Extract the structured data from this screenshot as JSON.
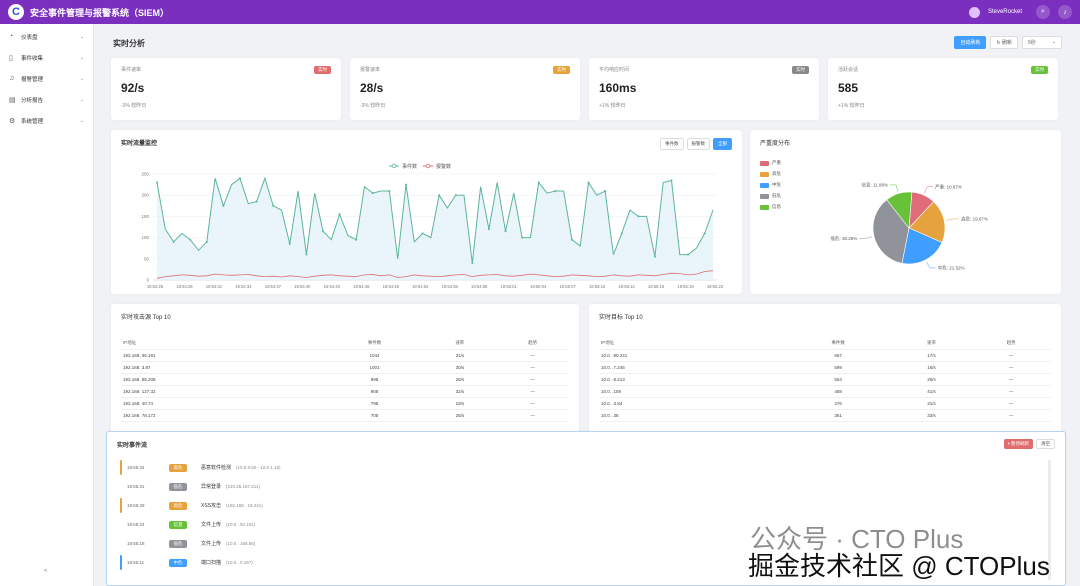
{
  "app": {
    "logo_letter": "C",
    "title": "安全事件管理与报警系统（SIEM）",
    "user": "SteveRocket"
  },
  "header_icons": [
    "search-icon",
    "bell-icon"
  ],
  "sidebar": {
    "items": [
      {
        "label": "仪表盘",
        "icon": "dashboard-icon"
      },
      {
        "label": "事件收集",
        "icon": "bookmark-icon"
      },
      {
        "label": "报警管理",
        "icon": "bell-icon"
      },
      {
        "label": "分析报告",
        "icon": "report-icon"
      },
      {
        "label": "系统管理",
        "icon": "gear-icon"
      }
    ],
    "collapse": "«"
  },
  "page": {
    "title": "实时分析",
    "auto_refresh_label": "自动刷新",
    "refresh_label": "刷新",
    "interval_value": "5秒"
  },
  "stats": [
    {
      "label": "事件速率",
      "value": "92/s",
      "badge": "实时",
      "badge_color": "#e06c6c",
      "sub": "-3% 较昨日"
    },
    {
      "label": "报警速率",
      "value": "28/s",
      "badge": "实时",
      "badge_color": "#e6a23c",
      "sub": "-3% 较昨日"
    },
    {
      "label": "平均响应时间",
      "value": "160ms",
      "badge": "实时",
      "badge_color": "#888888",
      "sub": "+1% 较昨日"
    },
    {
      "label": "活跃会话",
      "value": "585",
      "badge": "实时",
      "badge_color": "#67c23a",
      "sub": "+1% 较昨日"
    }
  ],
  "monitor": {
    "title": "实时流量监控",
    "tabs": [
      "事件数",
      "报警数",
      "全部"
    ],
    "active_tab": 2
  },
  "severity": {
    "title": "严重度分布",
    "legend": [
      {
        "label": "严重",
        "color": "#e06c7a"
      },
      {
        "label": "高危",
        "color": "#e6a23c"
      },
      {
        "label": "中危",
        "color": "#409eff"
      },
      {
        "label": "低危",
        "color": "#909399"
      },
      {
        "label": "信息",
        "color": "#67c23a"
      }
    ]
  },
  "chart_data": [
    {
      "type": "line",
      "legend_position": "top-center",
      "grid": true,
      "ylim": [
        0,
        250
      ],
      "yticks": [
        0,
        50,
        100,
        150,
        200,
        250
      ],
      "xticks": [
        "19:54:25",
        "19:54:28",
        "19:54:31",
        "19:54:34",
        "19:54:37",
        "19:54:40",
        "19:54:43",
        "19:54:46",
        "19:54:49",
        "19:54:52",
        "19:54:55",
        "19:54:58",
        "19:55:01",
        "19:55:04",
        "19:55:07",
        "19:55:10",
        "19:55:13",
        "19:55:16",
        "19:55:19",
        "19:55:22"
      ],
      "series": [
        {
          "name": "事件数",
          "color": "#5bb59a",
          "values": [
            230,
            120,
            90,
            110,
            95,
            70,
            90,
            240,
            175,
            225,
            240,
            180,
            185,
            240,
            175,
            165,
            85,
            210,
            60,
            205,
            115,
            95,
            155,
            105,
            95,
            220,
            205,
            210,
            210,
            50,
            225,
            90,
            110,
            100,
            200,
            170,
            200,
            200,
            40,
            220,
            120,
            230,
            115,
            205,
            100,
            100,
            230,
            205,
            210,
            210,
            95,
            80,
            230,
            200,
            210,
            60,
            110,
            165,
            150,
            150,
            55,
            230,
            235,
            60,
            60,
            75,
            110,
            165
          ]
        },
        {
          "name": "报警数",
          "color": "#e06c6c",
          "values": [
            4,
            8,
            10,
            12,
            11,
            9,
            10,
            14,
            12,
            11,
            12,
            13,
            10,
            8,
            9,
            7,
            10,
            8,
            6,
            9,
            11,
            12,
            10,
            9,
            8,
            12,
            13,
            10,
            12,
            6,
            8,
            12,
            10,
            9,
            8,
            10,
            12,
            13,
            8,
            11,
            12,
            13,
            10,
            9,
            11,
            14,
            12,
            10,
            8,
            9,
            12,
            11,
            10,
            8,
            9,
            12,
            10,
            9,
            12,
            11,
            10,
            13,
            16,
            15,
            12,
            14,
            20,
            22
          ]
        }
      ]
    },
    {
      "type": "pie",
      "slices": [
        {
          "label": "严重",
          "value": 10.67,
          "color": "#e06c7a",
          "callout": "严重: 10.67%"
        },
        {
          "label": "高危",
          "value": 19.67,
          "color": "#e6a23c",
          "callout": "高危: 19.67%"
        },
        {
          "label": "中危",
          "value": 21.52,
          "color": "#409eff",
          "callout": "中危: 21.52%"
        },
        {
          "label": "低危",
          "value": 36.26,
          "color": "#909399",
          "callout": "低危: 36.26%"
        },
        {
          "label": "信息",
          "value": 11.88,
          "color": "#67c23a",
          "callout": "信息: 11.88%"
        }
      ]
    }
  ],
  "top_sources": {
    "title": "实时攻击源 Top 10",
    "columns": [
      "IP地址",
      "事件数",
      "速率",
      "趋势"
    ],
    "rows": [
      [
        "192.168.  36.191",
        "1044",
        "31/s",
        "—"
      ],
      [
        "192.168.  3.87",
        "1001",
        "30/s",
        "—"
      ],
      [
        "192.168.  88.208",
        "998",
        "28/s",
        "—"
      ],
      [
        "192.168.  127.32",
        "908",
        "32/s",
        "—"
      ],
      [
        "192.168.  40.74",
        "795",
        "19/s",
        "—"
      ],
      [
        "192.168.  78.172",
        "705",
        "25/s",
        "—"
      ]
    ]
  },
  "top_targets": {
    "title": "实时目标 Top 10",
    "columns": [
      "IP地址",
      "事件数",
      "速率",
      "趋势"
    ],
    "rows": [
      [
        "10.0.  .90.221",
        "667",
        "17/s",
        "—"
      ],
      [
        "10.0.  .7.246",
        "599",
        "16/s",
        "—"
      ],
      [
        "10.0.  .8.213",
        "554",
        "26/s",
        "—"
      ],
      [
        "10.0.  .159",
        "488",
        "41/s",
        "—"
      ],
      [
        "10.0.  .3.84",
        "476",
        "31/s",
        "—"
      ],
      [
        "10.0.  .38",
        "361",
        "33/s",
        "—"
      ]
    ]
  },
  "events": {
    "title": "实时事件流",
    "pause_label": "⏸ 暂停刷新",
    "clear_label": "清空",
    "rows": [
      {
        "time": "19:55:34",
        "tag": "高危",
        "tag_color": "#e6a23c",
        "bar": "#e6a23c",
        "name": "恶意软件检测",
        "ip": "(10.0.9.50 - 10.0.1.18)"
      },
      {
        "time": "19:55:31",
        "tag": "低危",
        "tag_color": "#909399",
        "bar": "",
        "name": "异常登录",
        "ip": "(210.45.167.211)"
      },
      {
        "time": "19:55:28",
        "tag": "高危",
        "tag_color": "#e6a23c",
        "bar": "#e6a23c",
        "name": "XSS攻击",
        "ip": "(192.168.  .19.241)"
      },
      {
        "time": "19:55:24",
        "tag": "信息",
        "tag_color": "#67c23a",
        "bar": "",
        "name": "文件上传",
        "ip": "(10.0.  .92.101)"
      },
      {
        "time": "19:55:18",
        "tag": "低危",
        "tag_color": "#909399",
        "bar": "",
        "name": "文件上传",
        "ip": "(10.0.  .168.65)"
      },
      {
        "time": "19:55:11",
        "tag": "中危",
        "tag_color": "#409eff",
        "bar": "#409eff",
        "name": "端口扫描",
        "ip": "(10.0.  .0.167)"
      }
    ]
  },
  "watermark": {
    "line1": "公众号 · CTO Plus",
    "line2": "掘金技术社区 @ CTOPlus"
  }
}
